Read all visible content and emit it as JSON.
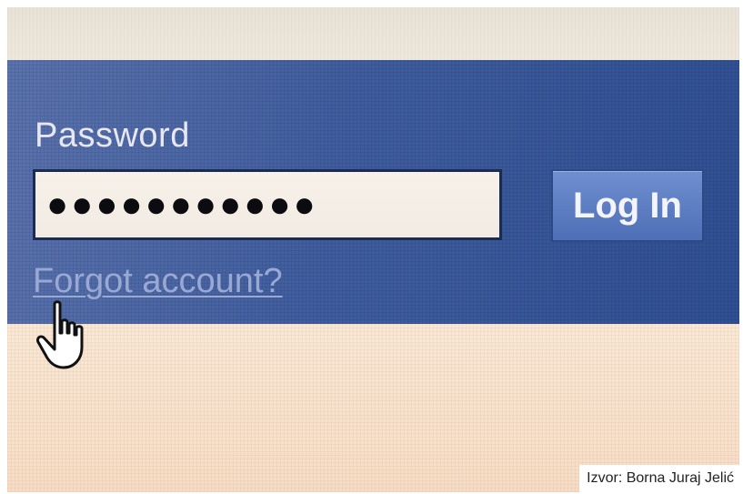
{
  "login": {
    "password_label": "Password",
    "password_value": "●●●●●●●●●●●",
    "login_button_label": "Log In",
    "forgot_link_label": "Forgot account?"
  },
  "credit": {
    "text": "Izvor: Borna Juraj Jelić"
  },
  "icons": {
    "cursor": "hand-pointer-icon"
  },
  "colors": {
    "header_blue": "#3f5d9e",
    "button_blue": "#5b7cc1",
    "screen_background": "#f7e6d3"
  }
}
